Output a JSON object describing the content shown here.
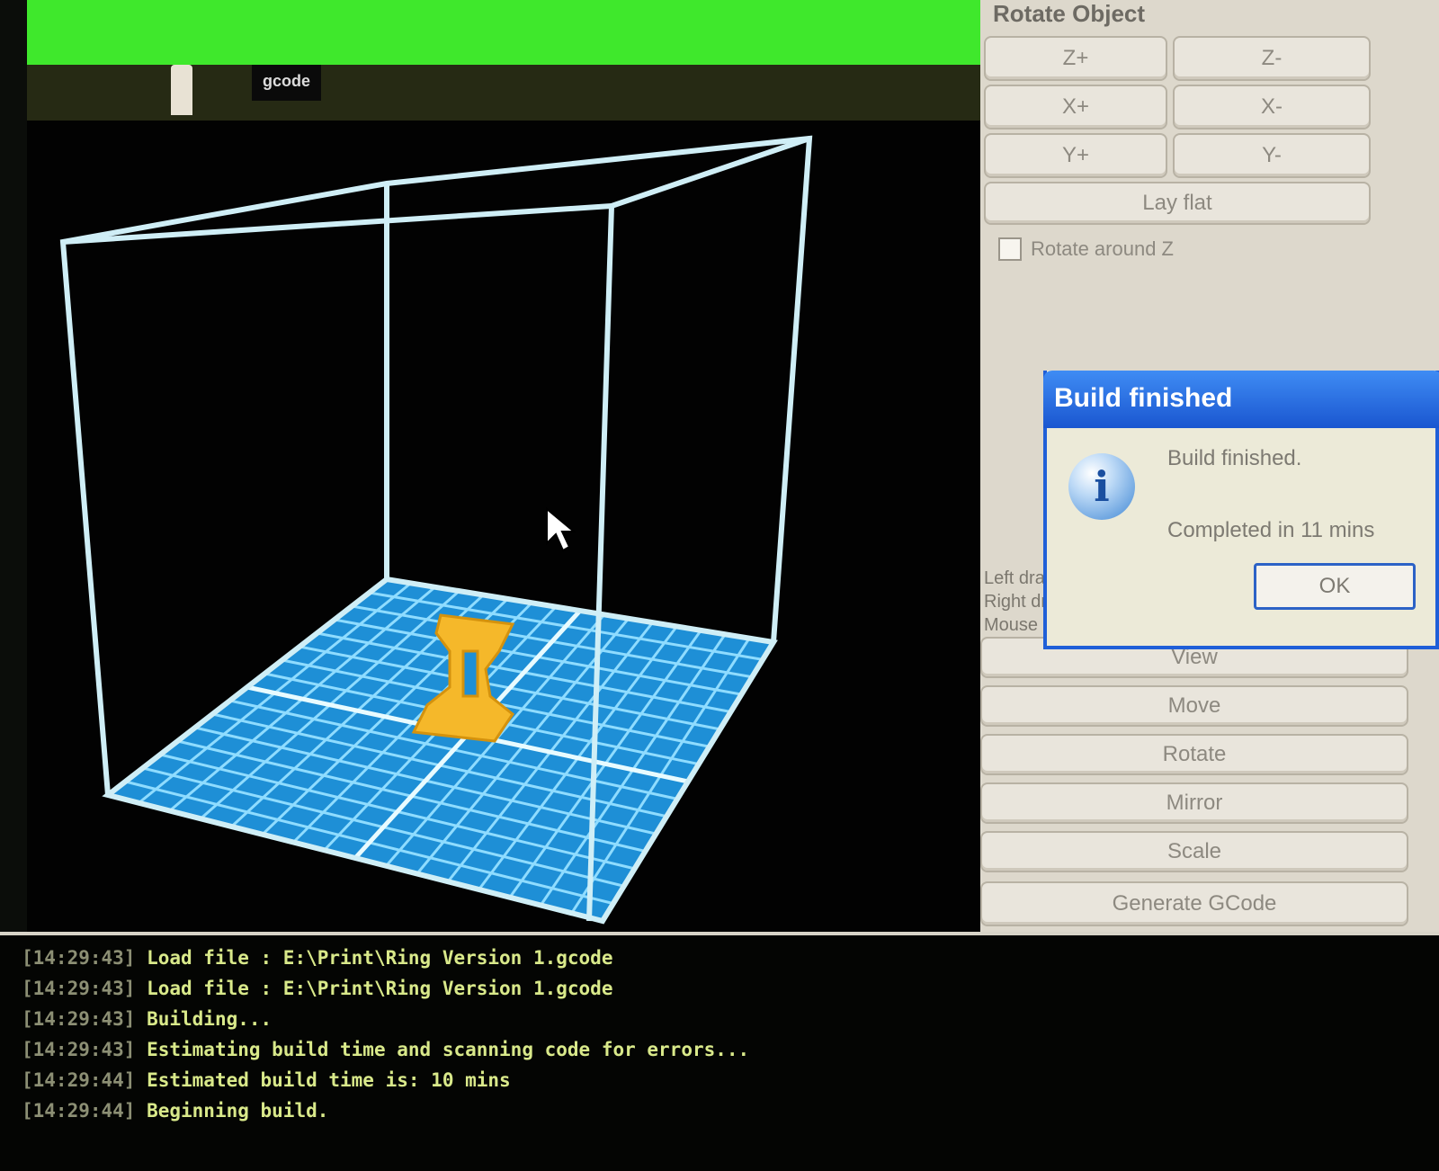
{
  "window": {
    "title": ""
  },
  "tabs": [
    {
      "label": ""
    },
    {
      "label": ""
    },
    {
      "label": "gcode"
    }
  ],
  "rotate_panel": {
    "title": "Rotate Object",
    "buttons": [
      "Z+",
      "Z-",
      "X+",
      "X-",
      "Y+",
      "Y-"
    ],
    "lay_flat": "Lay flat",
    "rotate_around_z": "Rotate around Z"
  },
  "hints": [
    "Left dra",
    "Right dr",
    "Mouse"
  ],
  "actions": [
    "View",
    "Move",
    "Rotate",
    "Mirror",
    "Scale",
    "Generate GCode"
  ],
  "dialog": {
    "title": "Build finished",
    "message": "Build finished.",
    "detail": "Completed in 11 mins",
    "ok": "OK"
  },
  "log": [
    {
      "time": "[14:29:43]",
      "msg": "Load file : E:\\Print\\Ring Version 1.gcode"
    },
    {
      "time": "[14:29:43]",
      "msg": "Load file : E:\\Print\\Ring Version 1.gcode"
    },
    {
      "time": "[14:29:43]",
      "msg": "Building..."
    },
    {
      "time": "[14:29:43]",
      "msg": "Estimating build time and scanning code for errors..."
    },
    {
      "time": "[14:29:44]",
      "msg": "Estimated build time is: 10 mins"
    },
    {
      "time": "[14:29:44]",
      "msg": "Beginning build."
    }
  ],
  "colors": {
    "titlebar": "#3fe82c",
    "grid_floor": "#1e8fd6",
    "grid_line": "#c8f0ff",
    "object": "#f5b82a",
    "dialog_title": "#1a56d0"
  }
}
